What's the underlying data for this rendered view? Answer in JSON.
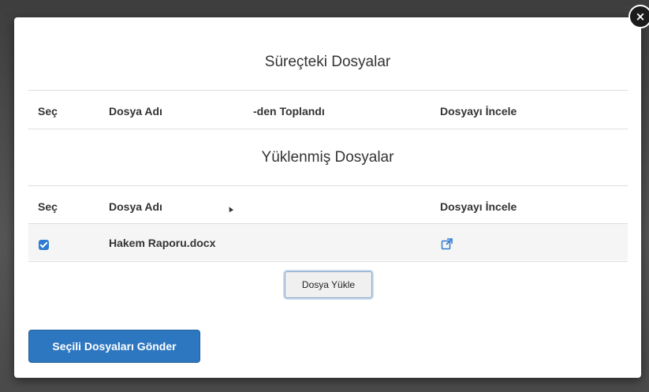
{
  "modal": {
    "close_symbol": "×",
    "process_files": {
      "title": "Süreçteki Dosyalar",
      "columns": [
        "Seç",
        "Dosya Adı",
        "-den Toplandı",
        "Dosyayı İncele"
      ]
    },
    "uploaded_files": {
      "title": "Yüklenmiş Dosyalar",
      "columns": [
        "Seç",
        "Dosya Adı",
        "Dosyayı İncele"
      ],
      "rows": [
        {
          "checked": true,
          "file_name": "Hakem Raporu.docx",
          "view_icon": "external-link-icon"
        }
      ]
    },
    "upload_button": "Dosya Yükle",
    "send_button": "Seçili Dosyaları Gönder"
  },
  "colors": {
    "primary": "#2d77c0",
    "checkbox": "#2f7bd1",
    "row_stripe": "#f5f5f5"
  }
}
